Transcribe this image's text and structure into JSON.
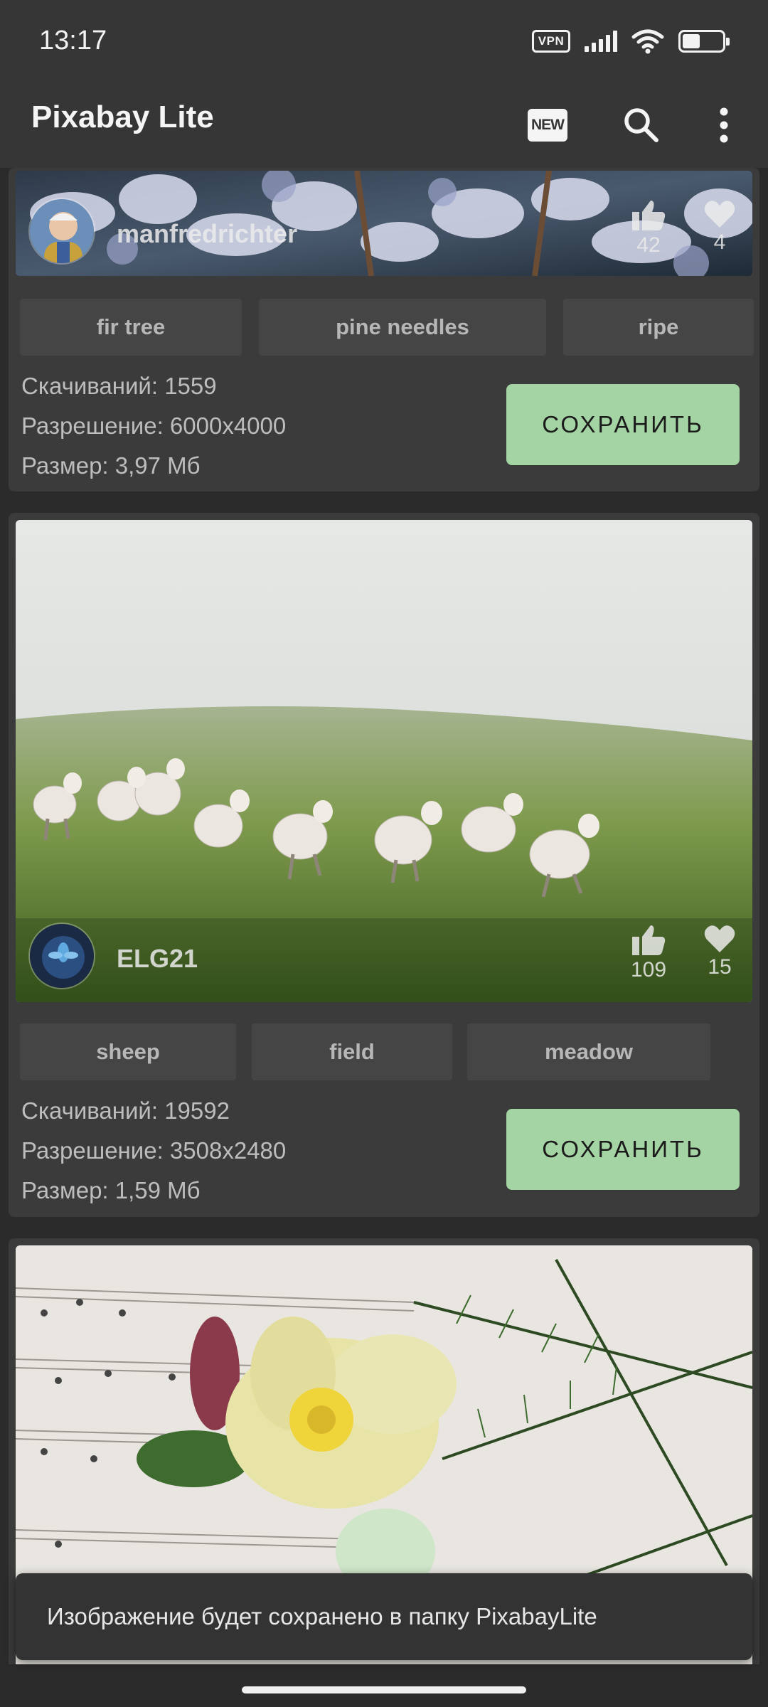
{
  "status_bar": {
    "time": "13:17",
    "vpn": "VPN"
  },
  "app_bar": {
    "title": "Pixabay Lite",
    "new_badge": "NEW",
    "icons": [
      "new-icon",
      "search-icon",
      "more-vert-icon"
    ]
  },
  "cards": [
    {
      "author": "manfredrichter",
      "likes": "42",
      "favorites": "4",
      "tags": [
        "fir tree",
        "pine needles",
        "ripe"
      ],
      "downloads": "Скачиваний: 1559",
      "resolution": "Разрешение: 6000x4000",
      "size": "Размер: 3,97 Мб",
      "save_label": "СОХРАНИТЬ"
    },
    {
      "author": "ELG21",
      "likes": "109",
      "favorites": "15",
      "tags": [
        "sheep",
        "field",
        "meadow"
      ],
      "downloads": "Скачиваний: 19592",
      "resolution": "Разрешение: 3508x2480",
      "size": "Размер: 1,59 Мб",
      "save_label": "СОХРАНИТЬ"
    }
  ],
  "snackbar": {
    "message": "Изображение будет сохранено в папку PixabayLite"
  },
  "colors": {
    "background": "#2b2b2b",
    "app_bar": "#363636",
    "card": "#3b3b3b",
    "save_button": "#a5d4a4"
  }
}
